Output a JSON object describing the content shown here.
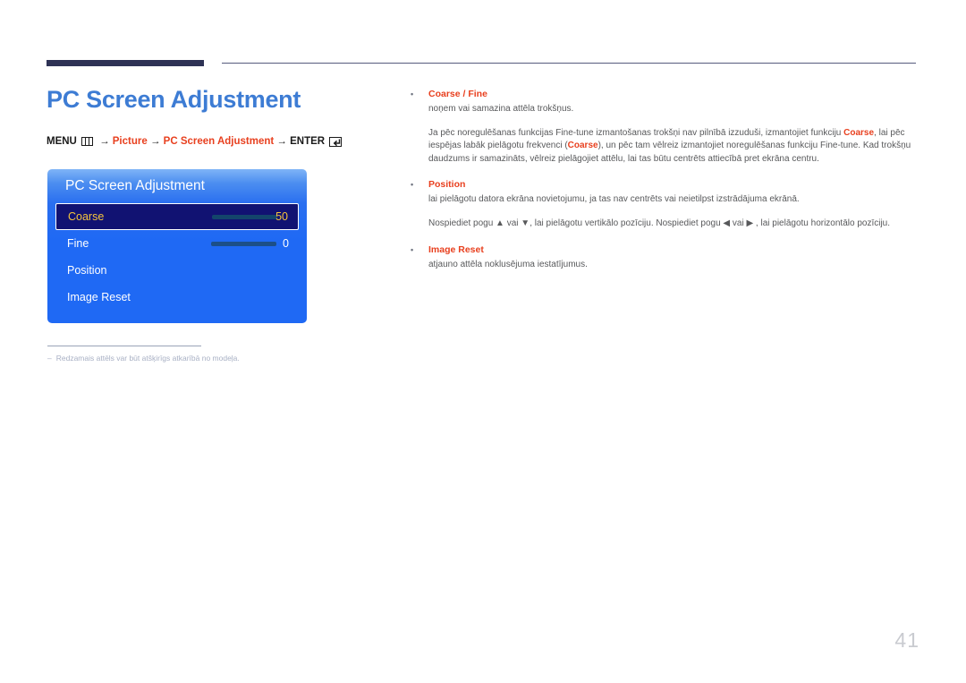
{
  "page": {
    "title": "PC Screen Adjustment",
    "number": "41",
    "accent_color": "#e8401f",
    "title_color": "#3d7cd4",
    "rule_color": "#2e3255"
  },
  "breadcrumb": {
    "menu_label": "MENU",
    "menu_icon": "menu-grid-icon",
    "arrow": " → ",
    "picture_label": "Picture",
    "screen_label": "PC Screen Adjustment",
    "enter_label": "ENTER",
    "enter_icon": "enter-key-icon"
  },
  "osd": {
    "title": "PC Screen Adjustment",
    "rows": [
      {
        "label": "Coarse",
        "value": "50",
        "has_slider": true,
        "fill_percent": 50,
        "selected": true
      },
      {
        "label": "Fine",
        "value": "0",
        "has_slider": true,
        "fill_percent": 0,
        "selected": false
      },
      {
        "label": "Position",
        "value": "",
        "has_slider": false,
        "fill_percent": 0,
        "selected": false
      },
      {
        "label": "Image Reset",
        "value": "",
        "has_slider": false,
        "fill_percent": 0,
        "selected": false
      }
    ],
    "selected_text_color": "#f5c43c",
    "selected_bg_color": "#111272",
    "panel_color": "#1f69f4",
    "slider_fill_color": "#9fe8dd"
  },
  "footnote": {
    "dash": "–",
    "text": "Redzamais attēls var būt atšķirīgs atkarībā no modeļa."
  },
  "content": {
    "bullet_char": "•",
    "sections": [
      {
        "heading_plain": "Coarse / Fine",
        "paragraphs": [
          "noņem vai samazina attēla trokšņus."
        ],
        "rich_paragraph": "Ja pēc noregulēšanas funkcijas Fine-tune izmantošanas trokšņi nav pilnībā izzuduši, izmantojiet funkciju Coarse, lai pēc iespējas labāk pielāgotu frekvenci (Coarse), un pēc tam vēlreiz izmantojiet noregulēšanas funkciju Fine-tune. Kad trokšņu daudzums ir samazināts, vēlreiz pielāgojiet attēlu, lai tas būtu centrēts attiecībā pret ekrāna centru."
      },
      {
        "heading_plain": "Position",
        "paragraphs": [
          "lai pielāgotu datora ekrāna novietojumu, ja tas nav centrēts vai neietilpst izstrādājuma ekrānā.",
          "Nospiediet pogu ▲ vai ▼, lai pielāgotu vertikālo pozīciju. Nospiediet pogu ◀ vai ▶ , lai pielāgotu horizontālo pozīciju."
        ]
      },
      {
        "heading_plain": "Image Reset",
        "paragraphs": [
          "atjauno attēla noklusējuma iestatījumus."
        ]
      }
    ]
  }
}
